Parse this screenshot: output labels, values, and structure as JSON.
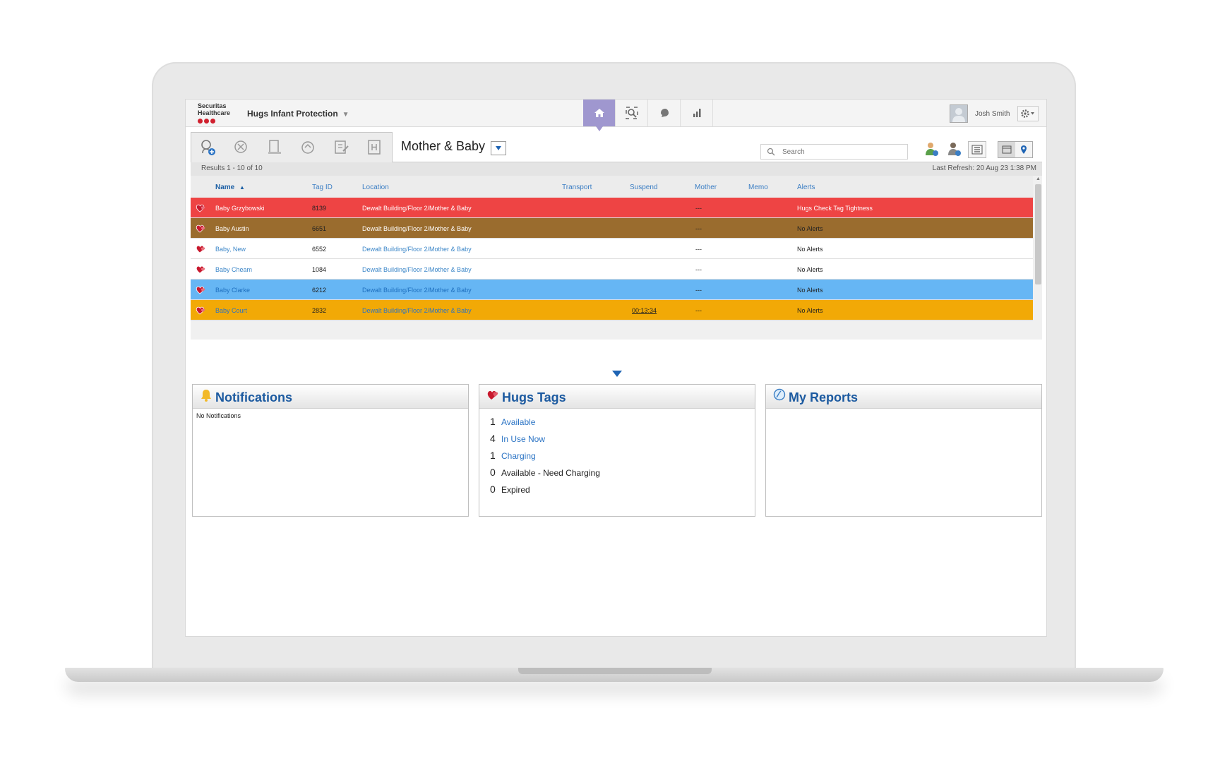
{
  "header": {
    "logo_line1": "Securitas",
    "logo_line2": "Healthcare",
    "app_title": "Hugs Infant Protection",
    "app_title_caret": "▼",
    "nav_tabs": [
      {
        "icon": "home-icon",
        "active": true
      },
      {
        "icon": "search-tag-icon",
        "active": false
      },
      {
        "icon": "baby-icon",
        "active": false
      },
      {
        "icon": "bar-chart-icon",
        "active": false
      }
    ],
    "user_name": "Josh Smith"
  },
  "toolbar": {
    "unit_title": "Mother & Baby",
    "search_placeholder": "Search",
    "tool_icons": [
      "admit-infant-icon",
      "discharge-icon",
      "bed-icon",
      "tag-exchange-icon",
      "edit-icon",
      "hospital-icon"
    ]
  },
  "results": {
    "summary": "Results 1 - 10 of 10",
    "last_refresh": "Last Refresh:  20 Aug 23 1:38 PM"
  },
  "table": {
    "columns": {
      "name": "Name",
      "tag_id": "Tag ID",
      "location": "Location",
      "transport": "Transport",
      "suspend": "Suspend",
      "mother": "Mother",
      "memo": "Memo",
      "alerts": "Alerts"
    },
    "sort_indicator": "▲",
    "rows": [
      {
        "name": "Baby Grzybowski",
        "tag_id": "8139",
        "location": "Dewalt Building/Floor 2/Mother & Baby",
        "transport": "",
        "suspend": "",
        "mother": "---",
        "memo": "",
        "alerts": "Hugs Check Tag Tightness",
        "bg": "#ee4444",
        "name_color": "#ffffff",
        "id_color": "#222222",
        "loc_color": "#ffffff",
        "alert_color": "#ffffff"
      },
      {
        "name": "Baby Austin",
        "tag_id": "6651",
        "location": "Dewalt Building/Floor 2/Mother & Baby",
        "transport": "",
        "suspend": "",
        "mother": "---",
        "memo": "",
        "alerts": "No Alerts",
        "bg": "#9a6c2e",
        "name_color": "#ffffff",
        "id_color": "#222222",
        "loc_color": "#ffffff",
        "alert_color": "#222222"
      },
      {
        "name": "Baby, New",
        "tag_id": "6552",
        "location": "Dewalt Building/Floor 2/Mother & Baby",
        "transport": "",
        "suspend": "",
        "mother": "---",
        "memo": "",
        "alerts": "No Alerts",
        "bg": "#ffffff",
        "name_color": "#3b86c8",
        "id_color": "#222222",
        "loc_color": "#3b86c8",
        "alert_color": "#222222"
      },
      {
        "name": "Baby Cheam",
        "tag_id": "1084",
        "location": "Dewalt Building/Floor 2/Mother & Baby",
        "transport": "",
        "suspend": "",
        "mother": "---",
        "memo": "",
        "alerts": "No Alerts",
        "bg": "#ffffff",
        "name_color": "#3b86c8",
        "id_color": "#222222",
        "loc_color": "#3b86c8",
        "alert_color": "#222222"
      },
      {
        "name": "Baby Clarke",
        "tag_id": "6212",
        "location": "Dewalt Building/Floor 2/Mother & Baby",
        "transport": "",
        "suspend": "",
        "mother": "---",
        "memo": "",
        "alerts": "No Alerts",
        "bg": "#66b6f4",
        "name_color": "#1e6fbf",
        "id_color": "#222222",
        "loc_color": "#1e6fbf",
        "alert_color": "#222222"
      },
      {
        "name": "Baby Court",
        "tag_id": "2832",
        "location": "Dewalt Building/Floor 2/Mother & Baby",
        "transport": "",
        "suspend": "00:13:34",
        "mother": "---",
        "memo": "",
        "alerts": "No Alerts",
        "bg": "#f2a906",
        "name_color": "#2a73c4",
        "id_color": "#222222",
        "loc_color": "#2a73c4",
        "alert_color": "#222222"
      }
    ]
  },
  "panels": {
    "notifications": {
      "title": "Notifications",
      "empty_text": "No Notifications"
    },
    "hugs_tags": {
      "title": "Hugs Tags",
      "items": [
        {
          "count": "1",
          "label": "Available",
          "link": true
        },
        {
          "count": "4",
          "label": "In Use Now",
          "link": true
        },
        {
          "count": "1",
          "label": "Charging",
          "link": true
        },
        {
          "count": "0",
          "label": "Available - Need Charging",
          "link": false
        },
        {
          "count": "0",
          "label": "Expired",
          "link": false
        }
      ]
    },
    "reports": {
      "title": "My Reports"
    }
  },
  "colors": {
    "accent": "#9f97cf",
    "link": "#2a73c4",
    "panel_title": "#1c5aa0",
    "logo_dots": "#d0202e"
  }
}
